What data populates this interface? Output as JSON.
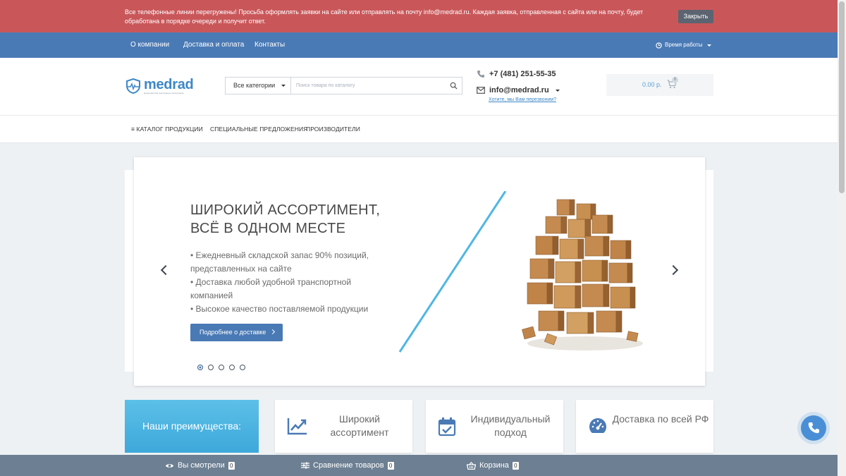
{
  "alert": {
    "text": "Все телефонные линии перегружены! Просьба оформлять заявки на сайте или отправлять на почту info@medrad.ru. Каждая заявка, отправленная с сайта или на почту, будет обработана в порядке очереди и получит ответ.",
    "close_label": "Закрыть"
  },
  "topnav": {
    "items": [
      "О компании",
      "Доставка и оплата",
      "Контакты"
    ],
    "worktime_label": "Время работы"
  },
  "header": {
    "logo_text": "medrad",
    "logo_tagline": "медицинские расходные материалы",
    "category_button": "Все категории",
    "search_placeholder": "Поиск товара по каталогу",
    "phone": "+7 (481) 251-55-35",
    "email": "info@medrad.ru",
    "callback_link": "Хотите, мы Вам перезвоним?",
    "cart_sum": "0.00 р.",
    "cart_count": "0"
  },
  "catnav": {
    "items": [
      "≡ КАТАЛОГ ПРОДУКЦИИ",
      "СПЕЦИАЛЬНЫЕ ПРЕДЛОЖЕНИЯ",
      "ПРОИЗВОДИТЕЛИ"
    ]
  },
  "slider": {
    "title_line1": "ШИРОКИЙ АССОРТИМЕНТ,",
    "title_line2": "ВСЁ В ОДНОМ МЕСТЕ",
    "bullets": [
      "• Ежедневный складской запас 90% позиций, представленных на сайте",
      "• Доставка любой удобной транспортной компанией",
      "• Высокое качество поставляемой продукции"
    ],
    "button_label": "Подробнее о доставке",
    "accent_color": "#4fb7e3"
  },
  "advantages": {
    "title": "Наши преимущества:",
    "cards": [
      {
        "text": "Широкий ассортимент",
        "icon": "trend-chart-icon"
      },
      {
        "text": "Индивидуальный подход",
        "icon": "calendar-check-icon"
      },
      {
        "text": "Доставка по всей РФ",
        "icon": "speedometer-icon"
      }
    ]
  },
  "bottombar": {
    "viewed_label": "Вы смотрели",
    "viewed_count": "0",
    "compare_label": "Сравнение товаров",
    "compare_count": "0",
    "cart_label": "Корзина",
    "cart_count": "0"
  },
  "colors": {
    "alert_bg": "#c9575a",
    "nav_bg": "#4a7ab5",
    "brand_blue": "#3e87c7",
    "bottombar_bg": "#6d7f92"
  }
}
